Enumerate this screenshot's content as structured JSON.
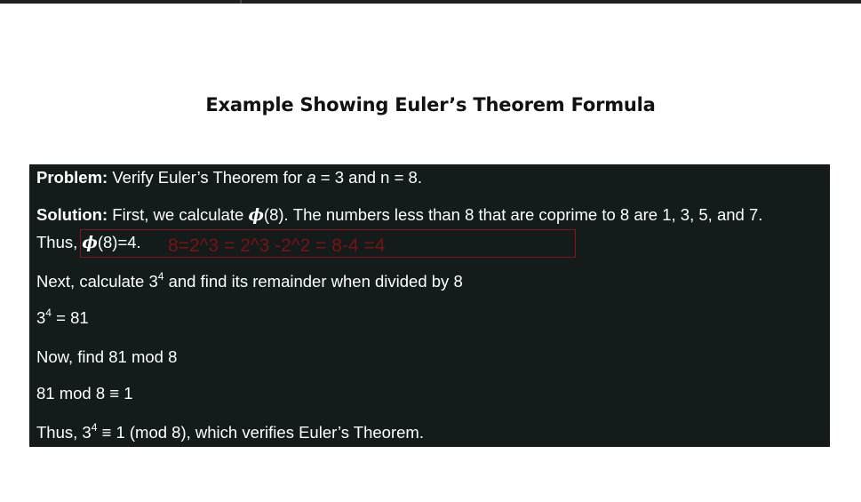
{
  "title": "Example Showing Euler’s Theorem Formula",
  "content": {
    "problem_label": "Problem:",
    "problem_pre": " Verify Euler’s Theorem for ",
    "problem_var": "a",
    "problem_post": " = 3 and n = 8.",
    "solution_label": "Solution:",
    "solution_pre": " First, we calculate ",
    "phi": "ϕ",
    "solution_post": "(8). The numbers less than 8 that are coprime to 8 are 1, 3, 5, and 7.",
    "thus_pre": "Thus, ",
    "thus_post": "(8)=4.",
    "next_pre": "Next, calculate 3",
    "next_sup": "4",
    "next_post": " and find its remainder when divided by 8",
    "pow_pre": "3",
    "pow_sup": "4",
    "pow_post": " = 81",
    "now_text": "Now, find 81 mod 8",
    "mod_text": "81 mod 8 ≡ 1",
    "final_pre": "Thus, 3",
    "final_sup": "4",
    "final_post": " ≡ 1 (mod 8), which verifies Euler’s Theorem."
  },
  "annotation": {
    "text": "8=2^3 = 2^3 -2^2 = 8-4 =4",
    "color": "#8a1414"
  },
  "colors": {
    "panel_bg": "#141b1b",
    "panel_text": "#ffffff",
    "title_text": "#111111"
  }
}
